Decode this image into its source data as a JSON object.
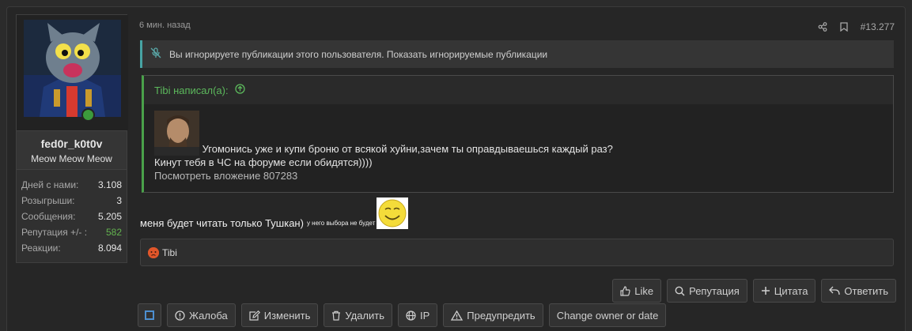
{
  "user": {
    "name": "fed0r_k0t0v",
    "title": "Meow Meow Meow",
    "stats": [
      {
        "label": "Дней с нами:",
        "value": "3.108"
      },
      {
        "label": "Розыгрыши:",
        "value": "3"
      },
      {
        "label": "Сообщения:",
        "value": "5.205"
      },
      {
        "label": "Репутация +/- :",
        "value": "582"
      },
      {
        "label": "Реакции:",
        "value": "8.094"
      }
    ]
  },
  "post": {
    "time": "6 мин. назад",
    "number": "#13.277",
    "ignored_notice": "Вы игнорируете публикации этого пользователя. Показать игнорируемые публикации",
    "quote_author": "Tibi написал(а):",
    "quote_line1": "Угомонись уже и купи броню от всякой хуйни,зачем ты оправдываешься каждый раз?",
    "quote_line2": "Кинут тебя в ЧС на форуме если обидятся))))",
    "quote_attachment": "Посмотреть вложение 807283",
    "message": "меня будет читать только Тушкан)",
    "message_small": "у него выбора не будет",
    "reaction_user": "Tibi"
  },
  "actions_primary": {
    "like": "Like",
    "reputation": "Репутация",
    "quote": "Цитата",
    "reply": "Ответить"
  },
  "actions_moderation": {
    "report": "Жалоба",
    "edit": "Изменить",
    "delete": "Удалить",
    "ip": "IP",
    "warn": "Предупредить",
    "change_owner": "Change owner or date"
  }
}
